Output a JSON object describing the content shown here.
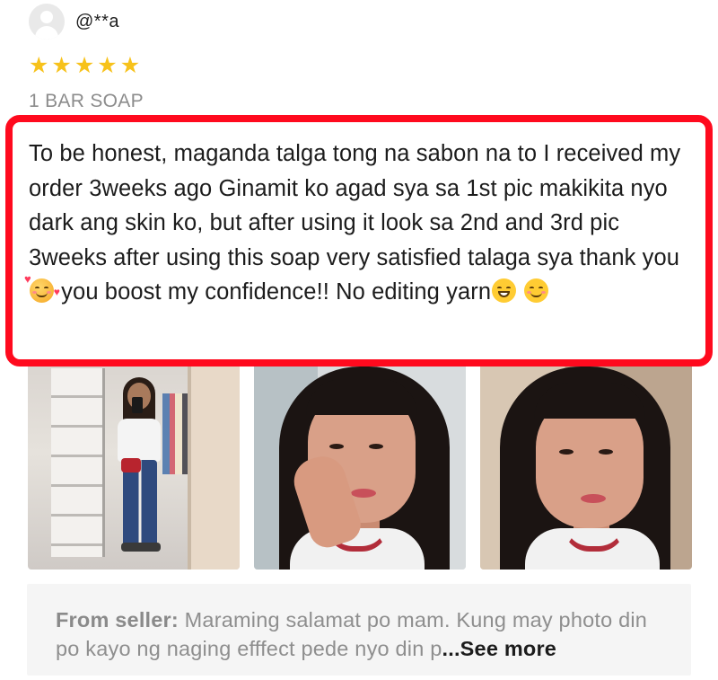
{
  "review": {
    "username": "@**a",
    "rating": 5,
    "stars": [
      "★",
      "★",
      "★",
      "★",
      "★"
    ],
    "variant": "1 BAR SOAP",
    "text_part1": "To be honest, maganda talga tong na sabon na to I received my order 3weeks ago Ginamit ko agad sya sa 1st pic makikita nyo dark ang skin ko, but after using it look sa 2nd and 3rd pic 3weeks after using this soap very satisfied talaga sya thank you",
    "text_part2": " you boost my confidence!! No editing yarn",
    "emojis": [
      "smiling-face-with-hearts-icon",
      "grinning-face-icon",
      "smiling-face-icon"
    ],
    "photo_count": 3,
    "highlight_color": "#ff0a1e",
    "star_color": "#f7c21b"
  },
  "seller_reply": {
    "label": "From seller:",
    "text": " Maraming salamat po mam. Kung may photo din po kayo ng naging efffect pede nyo din p",
    "see_more": "...See more"
  }
}
